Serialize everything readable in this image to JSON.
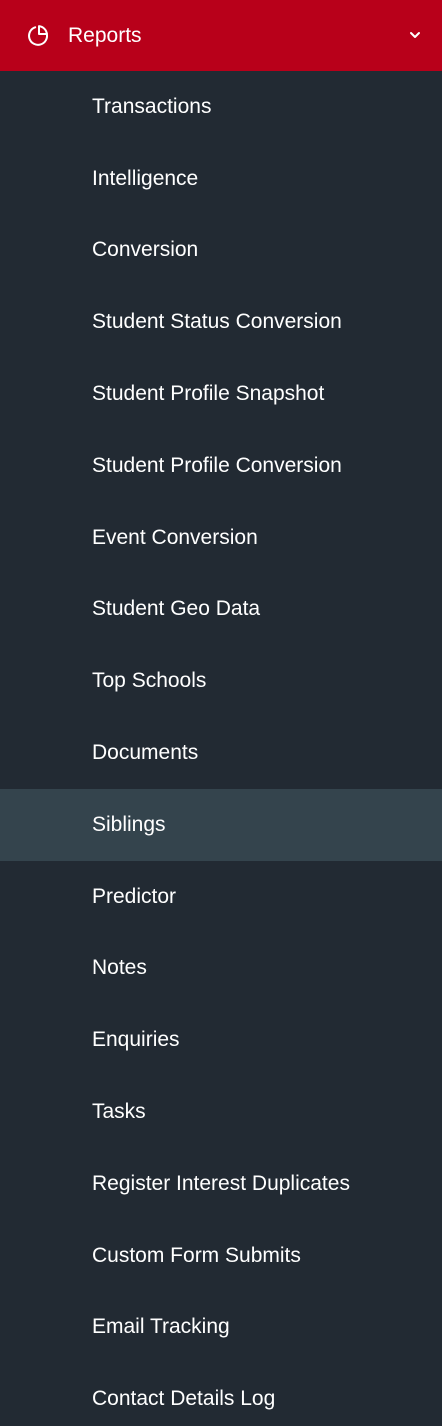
{
  "colors": {
    "header_bg": "#b8001a",
    "sidebar_bg": "#222a33",
    "active_bg": "#34444d",
    "text": "#ffffff"
  },
  "header": {
    "label": "Reports",
    "icon": "pie-chart-icon",
    "expand_icon": "chevron-down-icon"
  },
  "submenu": {
    "active": "Siblings",
    "items": [
      {
        "label": "Transactions"
      },
      {
        "label": "Intelligence"
      },
      {
        "label": "Conversion"
      },
      {
        "label": "Student Status Conversion"
      },
      {
        "label": "Student Profile Snapshot"
      },
      {
        "label": "Student Profile Conversion"
      },
      {
        "label": "Event Conversion"
      },
      {
        "label": "Student Geo Data"
      },
      {
        "label": "Top Schools"
      },
      {
        "label": "Documents"
      },
      {
        "label": "Siblings"
      },
      {
        "label": "Predictor"
      },
      {
        "label": "Notes"
      },
      {
        "label": "Enquiries"
      },
      {
        "label": "Tasks"
      },
      {
        "label": "Register Interest Duplicates"
      },
      {
        "label": "Custom Form Submits"
      },
      {
        "label": "Email Tracking"
      },
      {
        "label": "Contact Details Log"
      }
    ]
  }
}
